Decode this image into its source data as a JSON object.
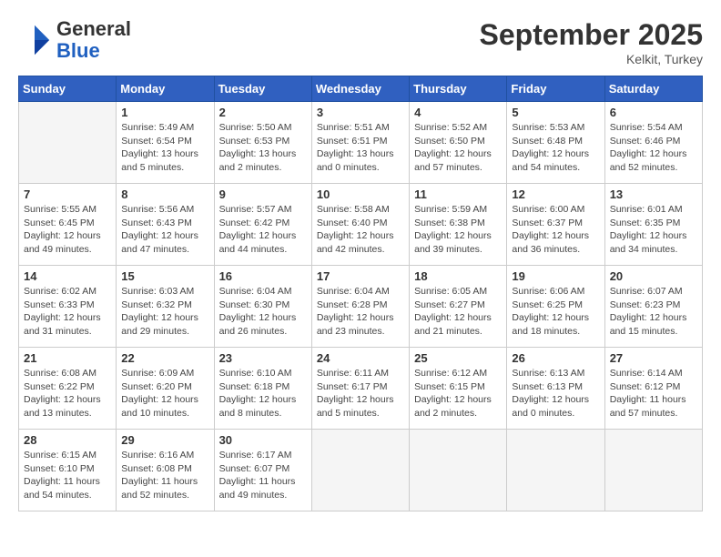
{
  "header": {
    "logo_general": "General",
    "logo_blue": "Blue",
    "month": "September 2025",
    "location": "Kelkit, Turkey"
  },
  "weekdays": [
    "Sunday",
    "Monday",
    "Tuesday",
    "Wednesday",
    "Thursday",
    "Friday",
    "Saturday"
  ],
  "weeks": [
    [
      {
        "day": "",
        "info": ""
      },
      {
        "day": "1",
        "info": "Sunrise: 5:49 AM\nSunset: 6:54 PM\nDaylight: 13 hours\nand 5 minutes."
      },
      {
        "day": "2",
        "info": "Sunrise: 5:50 AM\nSunset: 6:53 PM\nDaylight: 13 hours\nand 2 minutes."
      },
      {
        "day": "3",
        "info": "Sunrise: 5:51 AM\nSunset: 6:51 PM\nDaylight: 13 hours\nand 0 minutes."
      },
      {
        "day": "4",
        "info": "Sunrise: 5:52 AM\nSunset: 6:50 PM\nDaylight: 12 hours\nand 57 minutes."
      },
      {
        "day": "5",
        "info": "Sunrise: 5:53 AM\nSunset: 6:48 PM\nDaylight: 12 hours\nand 54 minutes."
      },
      {
        "day": "6",
        "info": "Sunrise: 5:54 AM\nSunset: 6:46 PM\nDaylight: 12 hours\nand 52 minutes."
      }
    ],
    [
      {
        "day": "7",
        "info": "Sunrise: 5:55 AM\nSunset: 6:45 PM\nDaylight: 12 hours\nand 49 minutes."
      },
      {
        "day": "8",
        "info": "Sunrise: 5:56 AM\nSunset: 6:43 PM\nDaylight: 12 hours\nand 47 minutes."
      },
      {
        "day": "9",
        "info": "Sunrise: 5:57 AM\nSunset: 6:42 PM\nDaylight: 12 hours\nand 44 minutes."
      },
      {
        "day": "10",
        "info": "Sunrise: 5:58 AM\nSunset: 6:40 PM\nDaylight: 12 hours\nand 42 minutes."
      },
      {
        "day": "11",
        "info": "Sunrise: 5:59 AM\nSunset: 6:38 PM\nDaylight: 12 hours\nand 39 minutes."
      },
      {
        "day": "12",
        "info": "Sunrise: 6:00 AM\nSunset: 6:37 PM\nDaylight: 12 hours\nand 36 minutes."
      },
      {
        "day": "13",
        "info": "Sunrise: 6:01 AM\nSunset: 6:35 PM\nDaylight: 12 hours\nand 34 minutes."
      }
    ],
    [
      {
        "day": "14",
        "info": "Sunrise: 6:02 AM\nSunset: 6:33 PM\nDaylight: 12 hours\nand 31 minutes."
      },
      {
        "day": "15",
        "info": "Sunrise: 6:03 AM\nSunset: 6:32 PM\nDaylight: 12 hours\nand 29 minutes."
      },
      {
        "day": "16",
        "info": "Sunrise: 6:04 AM\nSunset: 6:30 PM\nDaylight: 12 hours\nand 26 minutes."
      },
      {
        "day": "17",
        "info": "Sunrise: 6:04 AM\nSunset: 6:28 PM\nDaylight: 12 hours\nand 23 minutes."
      },
      {
        "day": "18",
        "info": "Sunrise: 6:05 AM\nSunset: 6:27 PM\nDaylight: 12 hours\nand 21 minutes."
      },
      {
        "day": "19",
        "info": "Sunrise: 6:06 AM\nSunset: 6:25 PM\nDaylight: 12 hours\nand 18 minutes."
      },
      {
        "day": "20",
        "info": "Sunrise: 6:07 AM\nSunset: 6:23 PM\nDaylight: 12 hours\nand 15 minutes."
      }
    ],
    [
      {
        "day": "21",
        "info": "Sunrise: 6:08 AM\nSunset: 6:22 PM\nDaylight: 12 hours\nand 13 minutes."
      },
      {
        "day": "22",
        "info": "Sunrise: 6:09 AM\nSunset: 6:20 PM\nDaylight: 12 hours\nand 10 minutes."
      },
      {
        "day": "23",
        "info": "Sunrise: 6:10 AM\nSunset: 6:18 PM\nDaylight: 12 hours\nand 8 minutes."
      },
      {
        "day": "24",
        "info": "Sunrise: 6:11 AM\nSunset: 6:17 PM\nDaylight: 12 hours\nand 5 minutes."
      },
      {
        "day": "25",
        "info": "Sunrise: 6:12 AM\nSunset: 6:15 PM\nDaylight: 12 hours\nand 2 minutes."
      },
      {
        "day": "26",
        "info": "Sunrise: 6:13 AM\nSunset: 6:13 PM\nDaylight: 12 hours\nand 0 minutes."
      },
      {
        "day": "27",
        "info": "Sunrise: 6:14 AM\nSunset: 6:12 PM\nDaylight: 11 hours\nand 57 minutes."
      }
    ],
    [
      {
        "day": "28",
        "info": "Sunrise: 6:15 AM\nSunset: 6:10 PM\nDaylight: 11 hours\nand 54 minutes."
      },
      {
        "day": "29",
        "info": "Sunrise: 6:16 AM\nSunset: 6:08 PM\nDaylight: 11 hours\nand 52 minutes."
      },
      {
        "day": "30",
        "info": "Sunrise: 6:17 AM\nSunset: 6:07 PM\nDaylight: 11 hours\nand 49 minutes."
      },
      {
        "day": "",
        "info": ""
      },
      {
        "day": "",
        "info": ""
      },
      {
        "day": "",
        "info": ""
      },
      {
        "day": "",
        "info": ""
      }
    ]
  ]
}
